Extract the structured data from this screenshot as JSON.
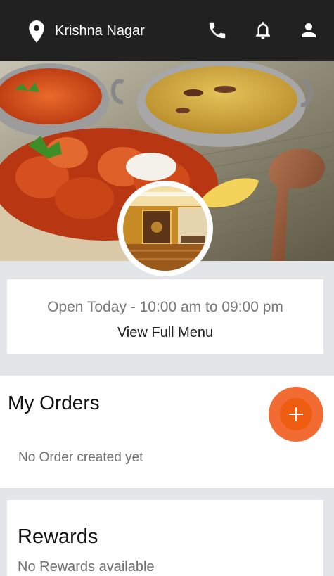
{
  "header": {
    "location": "Krishna Nagar",
    "icons": [
      "location-pin-icon",
      "phone-icon",
      "bell-icon",
      "user-icon"
    ]
  },
  "hours": {
    "text": "Open Today - 10:00 am to 09:00 pm",
    "menu_link": "View Full Menu"
  },
  "orders": {
    "title": "My Orders",
    "empty_text": "No Order created yet",
    "fab_icon": "plus-icon"
  },
  "rewards": {
    "title": "Rewards",
    "empty_text": "No Rewards available"
  },
  "colors": {
    "topbar": "#212121",
    "background": "#e2e6e9",
    "fab": "#f26b32",
    "fab_inner": "#ef5d12"
  }
}
